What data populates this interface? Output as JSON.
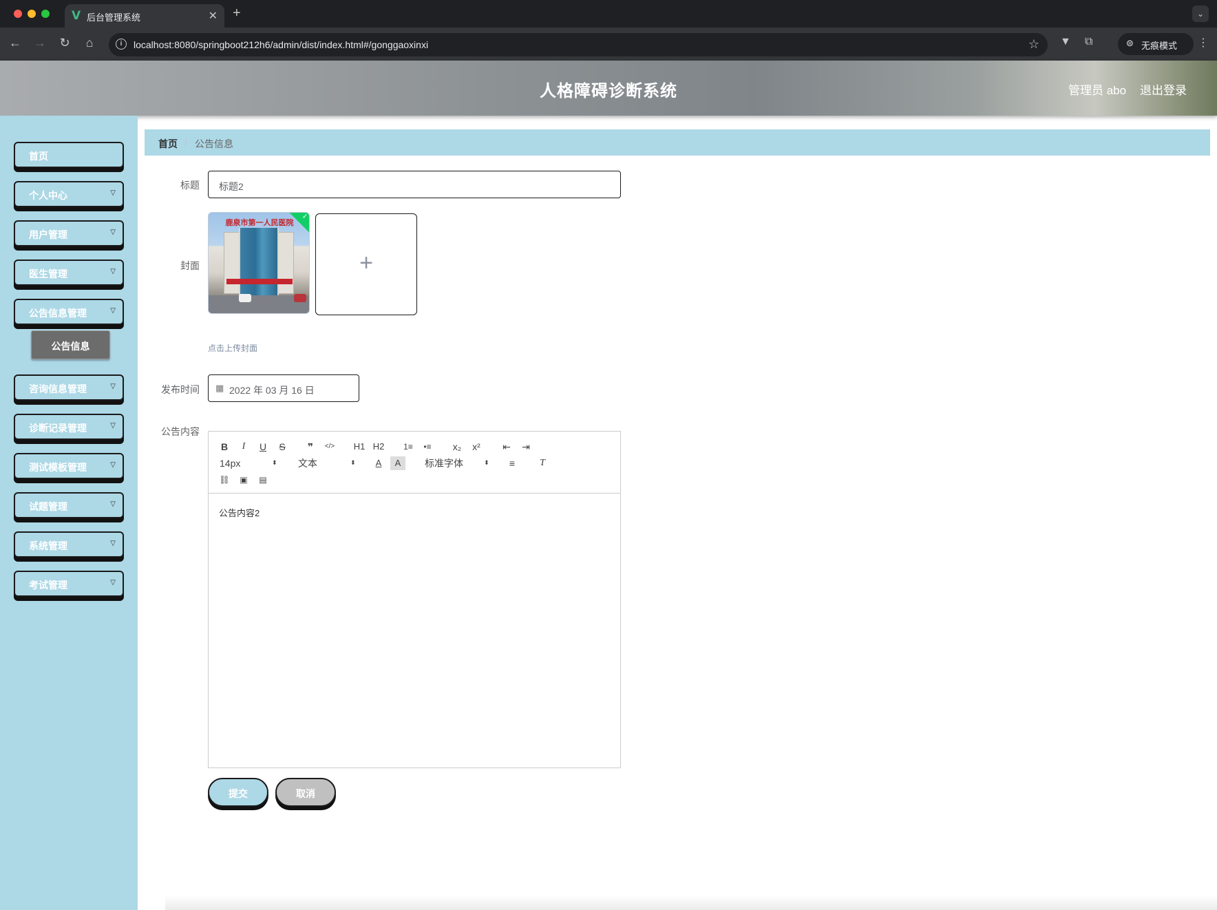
{
  "browser": {
    "tab_title": "后台管理系统",
    "tab_icon": "vue-logo-icon",
    "url": "localhost:8080/springboot212h6/admin/dist/index.html#/gonggaoxinxi",
    "incognito_label": "无痕模式"
  },
  "header": {
    "title": "人格障碍诊断系统",
    "admin_label": "管理员 abo",
    "logout_label": "退出登录"
  },
  "sidebar": {
    "items": [
      {
        "label": "首页",
        "expandable": false
      },
      {
        "label": "个人中心",
        "expandable": true
      },
      {
        "label": "用户管理",
        "expandable": true
      },
      {
        "label": "医生管理",
        "expandable": true
      },
      {
        "label": "公告信息管理",
        "expandable": true
      },
      {
        "label": "咨询信息管理",
        "expandable": true
      },
      {
        "label": "诊断记录管理",
        "expandable": true
      },
      {
        "label": "测试模板管理",
        "expandable": true
      },
      {
        "label": "试题管理",
        "expandable": true
      },
      {
        "label": "系统管理",
        "expandable": true
      },
      {
        "label": "考试管理",
        "expandable": true
      }
    ],
    "active_submenu": "公告信息"
  },
  "breadcrumb": {
    "home": "首页",
    "separator": "/",
    "current": "公告信息"
  },
  "form": {
    "title_label": "标题",
    "title_value": "标题2",
    "cover_label": "封面",
    "cover_sign_text": "鹿泉市第一人民医院",
    "upload_tip": "点击上传封面",
    "date_label": "发布时间",
    "date_value": "2022 年 03 月 16 日",
    "content_label": "公告内容",
    "content_value": "公告内容2"
  },
  "editor": {
    "toolbar_row1": [
      "B",
      "I",
      "U",
      "S",
      "❞",
      "</>",
      "H1",
      "H2",
      "1≡",
      "•≡",
      "x₂",
      "x²",
      "⇤",
      "⇥"
    ],
    "font_size": "14px",
    "header_select": "文本",
    "font_family": "标准字体",
    "row2_icons": [
      "font-color-icon",
      "background-color-icon",
      "align-icon",
      "clear-format-icon"
    ],
    "row3_icons": [
      "link-icon",
      "image-icon",
      "video-icon"
    ]
  },
  "buttons": {
    "submit": "提交",
    "cancel": "取消"
  },
  "colors": {
    "sidebar_bg": "#add8e6",
    "submenu_active_bg": "#6c6c6c",
    "cancel_bg": "#c0c0c0",
    "success_badge": "#13ce66"
  }
}
